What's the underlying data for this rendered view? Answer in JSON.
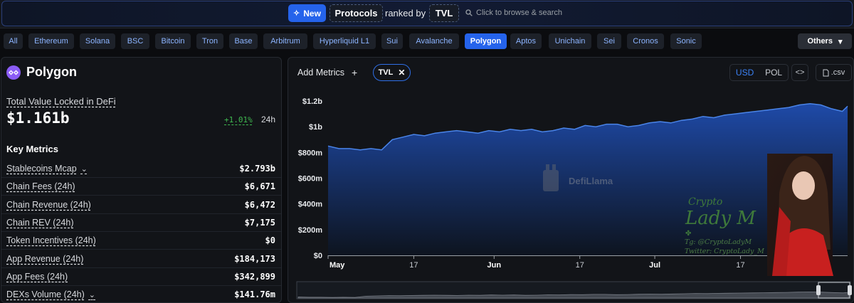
{
  "header": {
    "new_label": "New",
    "category": "Protocols",
    "ranked_by": "ranked by",
    "metric": "TVL",
    "search_placeholder": "Click to browse & search"
  },
  "chains": [
    {
      "label": "All"
    },
    {
      "label": "Ethereum"
    },
    {
      "label": "Solana"
    },
    {
      "label": "BSC"
    },
    {
      "label": "Bitcoin"
    },
    {
      "label": "Tron"
    },
    {
      "label": "Base"
    },
    {
      "label": "Arbitrum"
    },
    {
      "label": "Hyperliquid L1"
    },
    {
      "label": "Sui"
    },
    {
      "label": "Avalanche"
    },
    {
      "label": "Polygon",
      "active": true
    },
    {
      "label": "Aptos"
    },
    {
      "label": "Unichain"
    },
    {
      "label": "Sei"
    },
    {
      "label": "Cronos"
    },
    {
      "label": "Sonic"
    }
  ],
  "others_label": "Others",
  "summary": {
    "chain_name": "Polygon",
    "tvl_label": "Total Value Locked in DeFi",
    "tvl_value": "$1.161b",
    "tvl_change": "+1.01%",
    "tvl_period": "24h",
    "key_metrics_title": "Key Metrics",
    "metrics": [
      {
        "label": "Stablecoins Mcap",
        "value": "$2.793b",
        "expandable": true
      },
      {
        "label": "Chain Fees (24h)",
        "value": "$6,671"
      },
      {
        "label": "Chain Revenue (24h)",
        "value": "$6,472"
      },
      {
        "label": "Chain REV (24h)",
        "value": "$7,175"
      },
      {
        "label": "Token Incentives (24h)",
        "value": "$0"
      },
      {
        "label": "App Revenue (24h)",
        "value": "$184,173"
      },
      {
        "label": "App Fees (24h)",
        "value": "$342,899"
      },
      {
        "label": "DEXs Volume (24h)",
        "value": "$141.76m",
        "expandable": true
      }
    ]
  },
  "controls": {
    "add_metrics": "Add Metrics",
    "selected_metric": "TVL",
    "currency_usd": "USD",
    "currency_pol": "POL",
    "embed_icon": "code-icon",
    "csv_label": ".csv"
  },
  "watermark": {
    "brand": "DefiLlama",
    "overlay_line1": "Crypto",
    "overlay_line2": "Lady M",
    "overlay_tg": "Tg: @CryptoLadyM",
    "overlay_twitter": "Twitter: CryptoLady_M"
  },
  "colors": {
    "accent": "#2563eb",
    "positive": "#3fb950",
    "area_line": "#4a84e8",
    "area_fill_top": "#1f4db0",
    "area_fill_bottom": "#0d1420"
  },
  "chart_data": {
    "type": "area",
    "series": [
      {
        "name": "TVL",
        "x": [
          "2025-05-01",
          "2025-05-03",
          "2025-05-05",
          "2025-05-07",
          "2025-05-09",
          "2025-05-11",
          "2025-05-13",
          "2025-05-15",
          "2025-05-17",
          "2025-05-19",
          "2025-05-21",
          "2025-05-23",
          "2025-05-25",
          "2025-05-27",
          "2025-05-29",
          "2025-05-31",
          "2025-06-02",
          "2025-06-04",
          "2025-06-06",
          "2025-06-08",
          "2025-06-10",
          "2025-06-12",
          "2025-06-14",
          "2025-06-16",
          "2025-06-18",
          "2025-06-20",
          "2025-06-22",
          "2025-06-24",
          "2025-06-26",
          "2025-06-28",
          "2025-06-30",
          "2025-07-02",
          "2025-07-04",
          "2025-07-06",
          "2025-07-08",
          "2025-07-10",
          "2025-07-12",
          "2025-07-14",
          "2025-07-16",
          "2025-07-18",
          "2025-07-20",
          "2025-07-22",
          "2025-07-24",
          "2025-07-26",
          "2025-07-28",
          "2025-07-30",
          "2025-08-01",
          "2025-08-03",
          "2025-08-05",
          "2025-08-06"
        ],
        "values": [
          0.85,
          0.83,
          0.83,
          0.82,
          0.83,
          0.82,
          0.9,
          0.92,
          0.94,
          0.93,
          0.95,
          0.96,
          0.97,
          0.96,
          0.95,
          0.97,
          0.96,
          0.98,
          0.97,
          0.98,
          0.96,
          0.97,
          0.99,
          0.98,
          1.01,
          1.0,
          1.02,
          1.02,
          1.0,
          1.01,
          1.03,
          1.04,
          1.03,
          1.05,
          1.06,
          1.08,
          1.07,
          1.09,
          1.1,
          1.11,
          1.12,
          1.13,
          1.14,
          1.15,
          1.17,
          1.18,
          1.17,
          1.14,
          1.12,
          1.16
        ]
      }
    ],
    "y_unit": "USD",
    "yticks": [
      "$0",
      "$200m",
      "$400m",
      "$600m",
      "$800m",
      "$1b",
      "$1.2b"
    ],
    "ytick_values": [
      0,
      0.2,
      0.4,
      0.6,
      0.8,
      1.0,
      1.2
    ],
    "ylim": [
      0,
      1.25
    ],
    "xlim": [
      "2025-05-01",
      "2025-08-06"
    ],
    "xticks": [
      {
        "label": "May",
        "date": "2025-05-01",
        "bold": true
      },
      {
        "label": "17",
        "date": "2025-05-17"
      },
      {
        "label": "Jun",
        "date": "2025-06-01",
        "bold": true
      },
      {
        "label": "17",
        "date": "2025-06-17"
      },
      {
        "label": "Jul",
        "date": "2025-07-01",
        "bold": true
      },
      {
        "label": "17",
        "date": "2025-07-17"
      },
      {
        "label": "Aug",
        "date": "2025-08-01",
        "bold": true
      }
    ],
    "grid": false,
    "legend": "none",
    "has_brush": true
  }
}
